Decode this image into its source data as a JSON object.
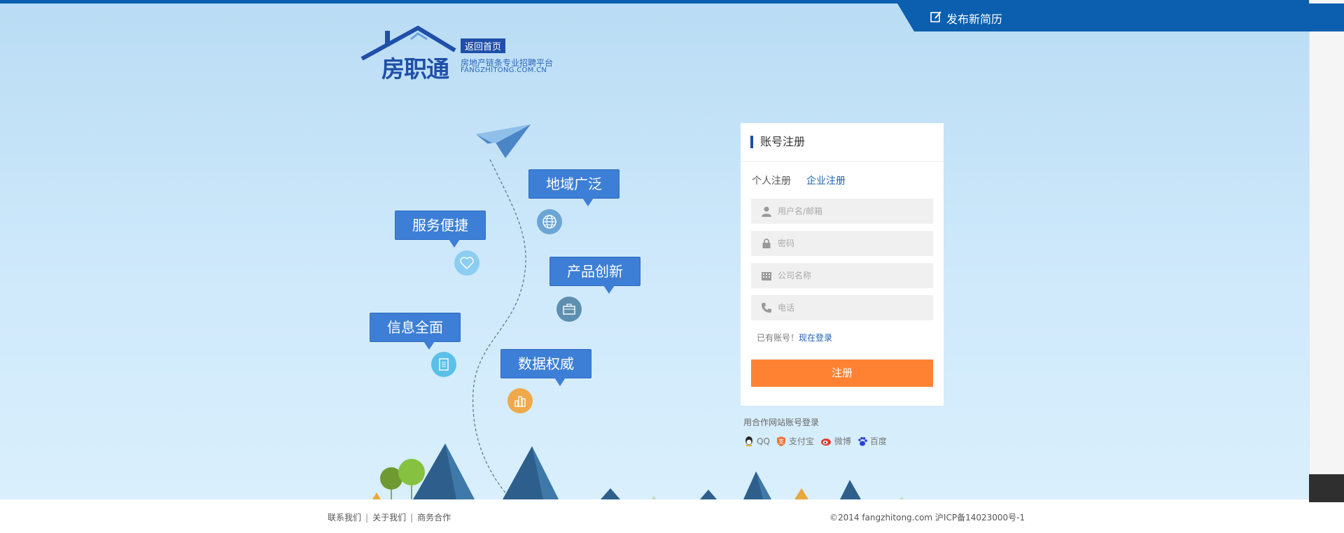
{
  "header": {
    "publish_label": "发布新简历"
  },
  "logo": {
    "brand": "房职通",
    "back_home": "返回首页",
    "slogan": "房地产链条专业招聘平台",
    "domain": "FANGZHITONG.COM.CN"
  },
  "features": {
    "f1": "地域广泛",
    "f2": "服务便捷",
    "f3": "产品创新",
    "f4": "信息全面",
    "f5": "数据权威"
  },
  "register": {
    "title": "账号注册",
    "tab_personal": "个人注册",
    "tab_company": "企业注册",
    "username_placeholder": "用户名/邮箱",
    "password_placeholder": "密码",
    "company_placeholder": "公司名称",
    "phone_placeholder": "电话",
    "have_account": "已有账号！",
    "login_link": "现在登录",
    "submit": "注册"
  },
  "partners": {
    "title": "用合作网站账号登录",
    "qq": "QQ",
    "alipay": "支付宝",
    "weibo": "微博",
    "baidu": "百度"
  },
  "footer": {
    "contact": "联系我们",
    "about": "关于我们",
    "business": "商务合作",
    "copyright": "©2014 fangzhitong.com 沪ICP备14023000号-1"
  },
  "colors": {
    "brand_blue": "#0b5fae",
    "button_orange": "#ff8233",
    "bubble_blue": "#3d7fd6"
  }
}
